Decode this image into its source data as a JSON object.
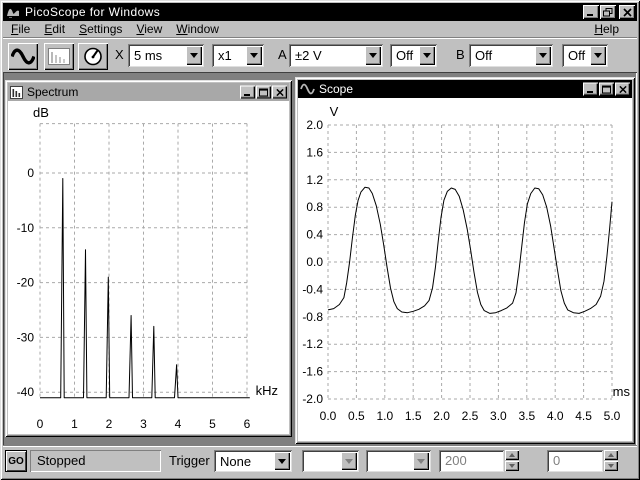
{
  "window": {
    "title": "PicoScope for Windows"
  },
  "menu": {
    "items": [
      "File",
      "Edit",
      "Settings",
      "View",
      "Window"
    ],
    "help": "Help"
  },
  "toolbar": {
    "x_label": "X",
    "timebase": "5 ms",
    "x_multiplier": "x1",
    "a_label": "A",
    "a_range": "±2 V",
    "a_coupling": "Off",
    "b_label": "B",
    "b_range": "Off",
    "b_coupling": "Off"
  },
  "spectrum_window": {
    "title": "Spectrum"
  },
  "scope_window": {
    "title": "Scope"
  },
  "statusbar": {
    "go_label": "GO",
    "status": "Stopped",
    "trigger_label": "Trigger",
    "trigger_mode": "None",
    "trigger_channel": "",
    "trigger_direction": "",
    "trigger_threshold": "200",
    "trigger_delay": "0"
  },
  "colors": {
    "titlebar_active": "#000000",
    "titlebar_inactive": "#a8a8a8",
    "silver": "#c0c0c0",
    "workspace": "#808080",
    "grid": "#aaaaaa",
    "trace": "#000000"
  },
  "chart_data": [
    {
      "type": "line",
      "title": "Spectrum",
      "xlabel": "kHz",
      "ylabel": "dB",
      "xlim": [
        0,
        6
      ],
      "ylim": [
        -41,
        9
      ],
      "grid": true,
      "xticks": [
        {
          "v": 0,
          "label": "0"
        },
        {
          "v": 1,
          "label": "1"
        },
        {
          "v": 2,
          "label": "2"
        },
        {
          "v": 3,
          "label": "3"
        },
        {
          "v": 4,
          "label": "4"
        },
        {
          "v": 5,
          "label": "5"
        },
        {
          "v": 6,
          "label": "6"
        }
      ],
      "yticks": [
        {
          "v": 0,
          "label": "0"
        },
        {
          "v": -10,
          "label": "-10"
        },
        {
          "v": -20,
          "label": "-20"
        },
        {
          "v": -30,
          "label": "-30"
        },
        {
          "v": -40,
          "label": "-40"
        }
      ],
      "unlabeled_gridlines_db": [
        9
      ],
      "baseline_db": -41,
      "peaks": [
        {
          "khz": 0.66,
          "db": -1
        },
        {
          "khz": 1.32,
          "db": -14
        },
        {
          "khz": 1.98,
          "db": -19
        },
        {
          "khz": 2.64,
          "db": -26
        },
        {
          "khz": 3.3,
          "db": -28
        },
        {
          "khz": 3.96,
          "db": -35
        }
      ]
    },
    {
      "type": "line",
      "title": "Scope",
      "xlabel": "ms",
      "ylabel": "V",
      "xlim": [
        0,
        5
      ],
      "ylim": [
        -2,
        2
      ],
      "grid": true,
      "xticks": [
        {
          "v": 0,
          "label": "0.0"
        },
        {
          "v": 0.5,
          "label": "0.5"
        },
        {
          "v": 1,
          "label": "1.0"
        },
        {
          "v": 1.5,
          "label": "1.5"
        },
        {
          "v": 2,
          "label": "2.0"
        },
        {
          "v": 2.5,
          "label": "2.5"
        },
        {
          "v": 3,
          "label": "3.0"
        },
        {
          "v": 3.5,
          "label": "3.5"
        },
        {
          "v": 4,
          "label": "4.0"
        },
        {
          "v": 4.5,
          "label": "4.5"
        },
        {
          "v": 5,
          "label": "5.0"
        }
      ],
      "yticks": [
        {
          "v": 2.0,
          "label": "2.0"
        },
        {
          "v": 1.6,
          "label": "1.6"
        },
        {
          "v": 1.2,
          "label": "1.2"
        },
        {
          "v": 0.8,
          "label": "0.8"
        },
        {
          "v": 0.4,
          "label": "0.4"
        },
        {
          "v": 0.0,
          "label": "0.0"
        },
        {
          "v": -0.4,
          "label": "-0.4"
        },
        {
          "v": -0.8,
          "label": "-0.8"
        },
        {
          "v": -1.2,
          "label": "-1.2"
        },
        {
          "v": -1.6,
          "label": "-1.6"
        },
        {
          "v": -2.0,
          "label": "-2.0"
        }
      ],
      "points": [
        [
          0.0,
          -0.7
        ],
        [
          0.1,
          -0.68
        ],
        [
          0.2,
          -0.62
        ],
        [
          0.28,
          -0.52
        ],
        [
          0.33,
          -0.3
        ],
        [
          0.38,
          0.0
        ],
        [
          0.43,
          0.35
        ],
        [
          0.48,
          0.68
        ],
        [
          0.53,
          0.9
        ],
        [
          0.58,
          1.02
        ],
        [
          0.65,
          1.09
        ],
        [
          0.72,
          1.08
        ],
        [
          0.78,
          1.0
        ],
        [
          0.85,
          0.82
        ],
        [
          0.92,
          0.55
        ],
        [
          0.98,
          0.25
        ],
        [
          1.04,
          -0.08
        ],
        [
          1.1,
          -0.38
        ],
        [
          1.16,
          -0.58
        ],
        [
          1.22,
          -0.68
        ],
        [
          1.3,
          -0.73
        ],
        [
          1.4,
          -0.74
        ],
        [
          1.5,
          -0.72
        ],
        [
          1.6,
          -0.69
        ],
        [
          1.7,
          -0.64
        ],
        [
          1.78,
          -0.56
        ],
        [
          1.84,
          -0.38
        ],
        [
          1.89,
          -0.08
        ],
        [
          1.94,
          0.3
        ],
        [
          1.99,
          0.65
        ],
        [
          2.04,
          0.9
        ],
        [
          2.1,
          1.03
        ],
        [
          2.17,
          1.08
        ],
        [
          2.24,
          1.06
        ],
        [
          2.31,
          0.96
        ],
        [
          2.38,
          0.76
        ],
        [
          2.45,
          0.48
        ],
        [
          2.51,
          0.18
        ],
        [
          2.57,
          -0.15
        ],
        [
          2.63,
          -0.44
        ],
        [
          2.69,
          -0.62
        ],
        [
          2.75,
          -0.71
        ],
        [
          2.85,
          -0.75
        ],
        [
          2.95,
          -0.74
        ],
        [
          3.05,
          -0.71
        ],
        [
          3.15,
          -0.67
        ],
        [
          3.25,
          -0.6
        ],
        [
          3.31,
          -0.45
        ],
        [
          3.36,
          -0.15
        ],
        [
          3.41,
          0.22
        ],
        [
          3.46,
          0.58
        ],
        [
          3.51,
          0.85
        ],
        [
          3.57,
          1.0
        ],
        [
          3.64,
          1.08
        ],
        [
          3.71,
          1.07
        ],
        [
          3.78,
          0.98
        ],
        [
          3.85,
          0.8
        ],
        [
          3.92,
          0.52
        ],
        [
          3.98,
          0.2
        ],
        [
          4.04,
          -0.12
        ],
        [
          4.1,
          -0.42
        ],
        [
          4.16,
          -0.6
        ],
        [
          4.22,
          -0.7
        ],
        [
          4.32,
          -0.74
        ],
        [
          4.42,
          -0.75
        ],
        [
          4.52,
          -0.72
        ],
        [
          4.62,
          -0.68
        ],
        [
          4.72,
          -0.62
        ],
        [
          4.8,
          -0.5
        ],
        [
          4.86,
          -0.28
        ],
        [
          4.91,
          0.08
        ],
        [
          4.96,
          0.5
        ],
        [
          5.0,
          0.88
        ]
      ]
    }
  ]
}
